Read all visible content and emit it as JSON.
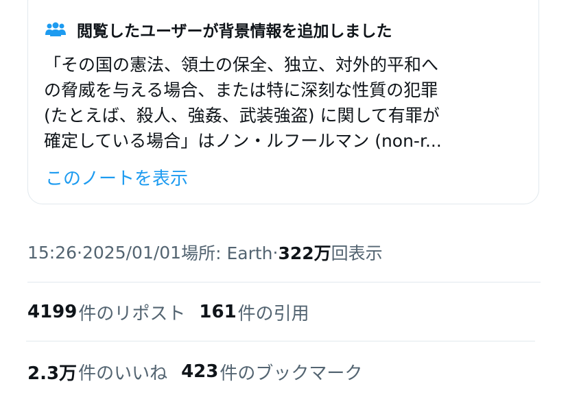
{
  "note": {
    "title": "閲覧したユーザーが背景情報を追加しました",
    "icon": "people-icon",
    "lines": [
      "「その国の憲法、領土の保全、独立、対外的平和へ",
      "の脅威を与える場合、または特に深刻な性質の犯罪",
      "(たとえば、殺人、強姦、武装強盗) に関して有罪が",
      "確定している場合」はノン・ルフールマン (non-r..."
    ],
    "show_link": "このノートを表示"
  },
  "meta": {
    "time": "15:26",
    "sep1": " · ",
    "date": "2025/01/01",
    "location": " 場所: Earth",
    "sep2": " · ",
    "views_count": "322万",
    "views_label": "回表示"
  },
  "stats": {
    "reposts_count": "4199",
    "reposts_label": "件のリポスト",
    "quotes_count": "161",
    "quotes_label": "件の引用",
    "likes_count": "2.3万",
    "likes_label": "件のいいね",
    "bookmarks_count": "423",
    "bookmarks_label": "件のブックマーク"
  },
  "colors": {
    "link": "#1d9bf0",
    "secondary_text": "#536471",
    "primary_text": "#0f1419",
    "border": "#e1e8ed"
  }
}
